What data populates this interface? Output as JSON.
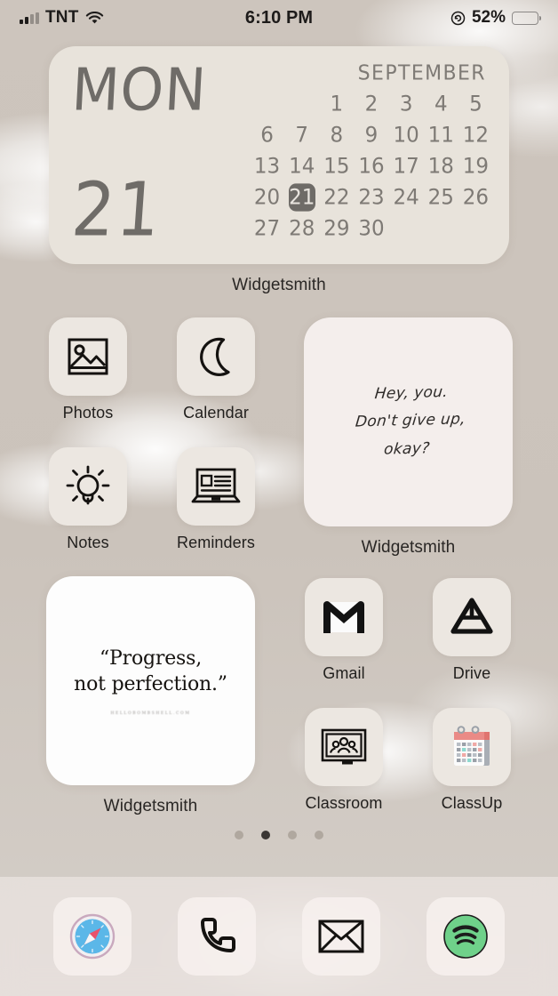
{
  "status_bar": {
    "carrier": "TNT",
    "signal_icon": "signal-bars-icon",
    "wifi_icon": "wifi-icon",
    "time": "6:10 PM",
    "orientation_lock_icon": "rotation-lock-icon",
    "battery_percent": "52%",
    "battery_level": 52,
    "battery_icon": "battery-icon"
  },
  "calendar_widget": {
    "label": "Widgetsmith",
    "day_of_week": "MON",
    "day_number": "21",
    "month": "SEPTEMBER",
    "today": 21,
    "leading_blanks": 2,
    "days": [
      1,
      2,
      3,
      4,
      5,
      6,
      7,
      8,
      9,
      10,
      11,
      12,
      13,
      14,
      15,
      16,
      17,
      18,
      19,
      20,
      21,
      22,
      23,
      24,
      25,
      26,
      27,
      28,
      29,
      30
    ],
    "highlight_color": "#6e6b67",
    "text_color": "#7e7a75",
    "background": "#e8e3db"
  },
  "note_widget": {
    "label": "Widgetsmith",
    "lines": [
      "Hey, you.",
      "Don't give up,",
      "okay?"
    ],
    "background": "#f4eeec"
  },
  "quote_widget": {
    "label": "Widgetsmith",
    "line1": "“Progress,",
    "line2": "not perfection.”",
    "source": "HELLOBOMBSHELL.COM",
    "background": "#fdfdfd"
  },
  "apps": {
    "row1": [
      {
        "label": "Photos",
        "icon": "photos-picture-icon"
      },
      {
        "label": "Calendar",
        "icon": "crescent-moon-icon"
      }
    ],
    "row2": [
      {
        "label": "Notes",
        "icon": "lightbulb-icon"
      },
      {
        "label": "Reminders",
        "icon": "laptop-article-icon"
      }
    ],
    "row3": [
      {
        "label": "Gmail",
        "icon": "gmail-envelope-m-icon"
      },
      {
        "label": "Drive",
        "icon": "google-drive-triangle-icon"
      }
    ],
    "row4": [
      {
        "label": "Classroom",
        "icon": "classroom-board-people-icon"
      },
      {
        "label": "ClassUp",
        "icon": "classup-calendar-icon"
      }
    ]
  },
  "page_dots": {
    "count": 4,
    "active_index": 1
  },
  "dock": [
    {
      "name": "Safari",
      "icon": "safari-compass-icon"
    },
    {
      "name": "Phone",
      "icon": "phone-handset-icon"
    },
    {
      "name": "Mail",
      "icon": "mail-envelope-icon"
    },
    {
      "name": "Spotify",
      "icon": "spotify-icon"
    }
  ],
  "colors": {
    "wallpaper": "#cdc5bd",
    "tile": "#ece7e1",
    "label_text": "#211f1d",
    "spotify_green": "#6fd18a",
    "classup_red": "#e8837f",
    "safari_blue": "#5bb7e8"
  }
}
